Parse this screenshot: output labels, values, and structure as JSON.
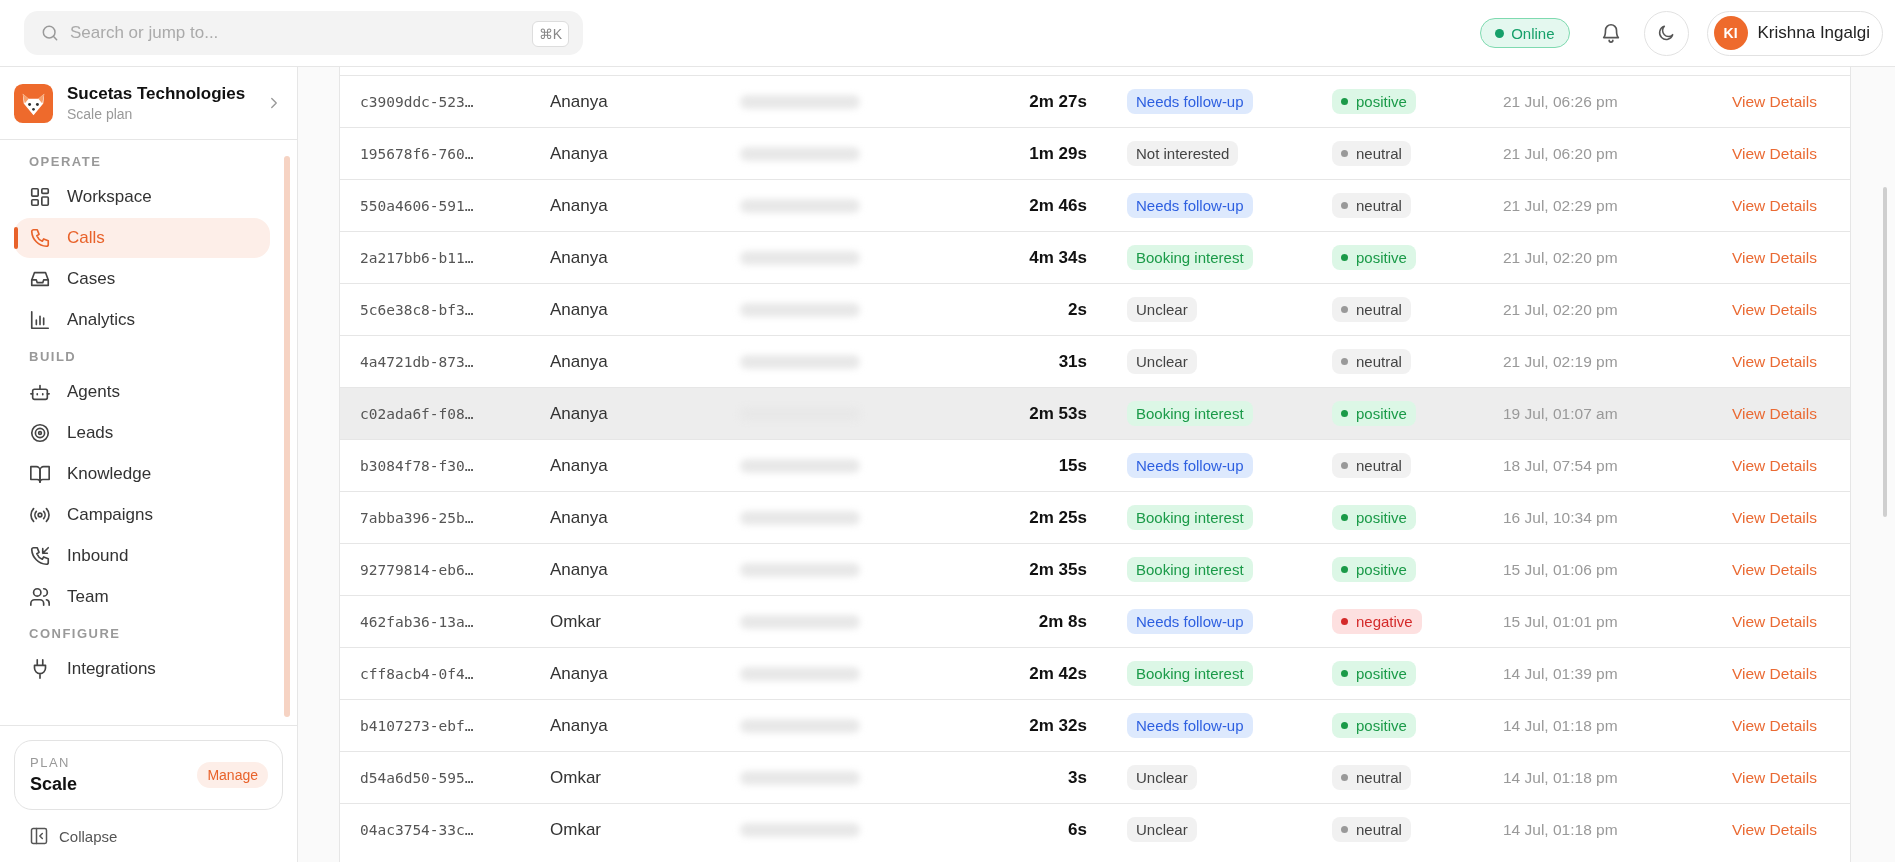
{
  "topbar": {
    "search": {
      "placeholder": "Search or jump to...",
      "shortcut": "⌘K"
    },
    "status": {
      "label": "Online",
      "online": true
    },
    "user": {
      "initials": "KI",
      "name": "Krishna Ingalgi"
    }
  },
  "sidebar": {
    "org": {
      "name": "Sucetas Technologies",
      "plan": "Scale plan"
    },
    "sections": [
      {
        "title": "OPERATE",
        "items": [
          {
            "label": "Workspace",
            "selected": false
          },
          {
            "label": "Calls",
            "selected": true
          },
          {
            "label": "Cases",
            "selected": false
          },
          {
            "label": "Analytics",
            "selected": false
          }
        ]
      },
      {
        "title": "BUILD",
        "items": [
          {
            "label": "Agents",
            "selected": false
          },
          {
            "label": "Leads",
            "selected": false
          },
          {
            "label": "Knowledge",
            "selected": false
          },
          {
            "label": "Campaigns",
            "selected": false
          },
          {
            "label": "Inbound",
            "selected": false
          },
          {
            "label": "Team",
            "selected": false
          }
        ]
      },
      {
        "title": "CONFIGURE",
        "items": [
          {
            "label": "Integrations",
            "selected": false
          }
        ]
      }
    ],
    "plan_card": {
      "label": "PLAN",
      "value": "Scale",
      "action": "Manage"
    },
    "collapse": "Collapse"
  },
  "table": {
    "rows": [
      {
        "id": "c3909ddc-523…",
        "agent": "Ananya",
        "duration": "2m 27s",
        "outcome": {
          "label": "Needs follow-up",
          "kind": "followup"
        },
        "sentiment": {
          "label": "positive",
          "kind": "positive"
        },
        "date": "21 Jul, 06:26 pm",
        "action": "View Details",
        "highlighted": false
      },
      {
        "id": "195678f6-760…",
        "agent": "Ananya",
        "duration": "1m 29s",
        "outcome": {
          "label": "Not interested",
          "kind": "neutral"
        },
        "sentiment": {
          "label": "neutral",
          "kind": "neutral"
        },
        "date": "21 Jul, 06:20 pm",
        "action": "View Details",
        "highlighted": false
      },
      {
        "id": "550a4606-591…",
        "agent": "Ananya",
        "duration": "2m 46s",
        "outcome": {
          "label": "Needs follow-up",
          "kind": "followup"
        },
        "sentiment": {
          "label": "neutral",
          "kind": "neutral"
        },
        "date": "21 Jul, 02:29 pm",
        "action": "View Details",
        "highlighted": false
      },
      {
        "id": "2a217bb6-b11…",
        "agent": "Ananya",
        "duration": "4m 34s",
        "outcome": {
          "label": "Booking interest",
          "kind": "booking"
        },
        "sentiment": {
          "label": "positive",
          "kind": "positive"
        },
        "date": "21 Jul, 02:20 pm",
        "action": "View Details",
        "highlighted": false
      },
      {
        "id": "5c6e38c8-bf3…",
        "agent": "Ananya",
        "duration": "2s",
        "outcome": {
          "label": "Unclear",
          "kind": "neutral"
        },
        "sentiment": {
          "label": "neutral",
          "kind": "neutral"
        },
        "date": "21 Jul, 02:20 pm",
        "action": "View Details",
        "highlighted": false
      },
      {
        "id": "4a4721db-873…",
        "agent": "Ananya",
        "duration": "31s",
        "outcome": {
          "label": "Unclear",
          "kind": "neutral"
        },
        "sentiment": {
          "label": "neutral",
          "kind": "neutral"
        },
        "date": "21 Jul, 02:19 pm",
        "action": "View Details",
        "highlighted": false
      },
      {
        "id": "c02ada6f-f08…",
        "agent": "Ananya",
        "duration": "2m 53s",
        "outcome": {
          "label": "Booking interest",
          "kind": "booking"
        },
        "sentiment": {
          "label": "positive",
          "kind": "positive"
        },
        "date": "19 Jul, 01:07 am",
        "action": "View Details",
        "highlighted": true
      },
      {
        "id": "b3084f78-f30…",
        "agent": "Ananya",
        "duration": "15s",
        "outcome": {
          "label": "Needs follow-up",
          "kind": "followup"
        },
        "sentiment": {
          "label": "neutral",
          "kind": "neutral"
        },
        "date": "18 Jul, 07:54 pm",
        "action": "View Details",
        "highlighted": false
      },
      {
        "id": "7abba396-25b…",
        "agent": "Ananya",
        "duration": "2m 25s",
        "outcome": {
          "label": "Booking interest",
          "kind": "booking"
        },
        "sentiment": {
          "label": "positive",
          "kind": "positive"
        },
        "date": "16 Jul, 10:34 pm",
        "action": "View Details",
        "highlighted": false
      },
      {
        "id": "92779814-eb6…",
        "agent": "Ananya",
        "duration": "2m 35s",
        "outcome": {
          "label": "Booking interest",
          "kind": "booking"
        },
        "sentiment": {
          "label": "positive",
          "kind": "positive"
        },
        "date": "15 Jul, 01:06 pm",
        "action": "View Details",
        "highlighted": false
      },
      {
        "id": "462fab36-13a…",
        "agent": "Omkar",
        "duration": "2m 8s",
        "outcome": {
          "label": "Needs follow-up",
          "kind": "followup"
        },
        "sentiment": {
          "label": "negative",
          "kind": "negative"
        },
        "date": "15 Jul, 01:01 pm",
        "action": "View Details",
        "highlighted": false
      },
      {
        "id": "cff8acb4-0f4…",
        "agent": "Ananya",
        "duration": "2m 42s",
        "outcome": {
          "label": "Booking interest",
          "kind": "booking"
        },
        "sentiment": {
          "label": "positive",
          "kind": "positive"
        },
        "date": "14 Jul, 01:39 pm",
        "action": "View Details",
        "highlighted": false
      },
      {
        "id": "b4107273-ebf…",
        "agent": "Ananya",
        "duration": "2m 32s",
        "outcome": {
          "label": "Needs follow-up",
          "kind": "followup"
        },
        "sentiment": {
          "label": "positive",
          "kind": "positive"
        },
        "date": "14 Jul, 01:18 pm",
        "action": "View Details",
        "highlighted": false
      },
      {
        "id": "d54a6d50-595…",
        "agent": "Omkar",
        "duration": "3s",
        "outcome": {
          "label": "Unclear",
          "kind": "neutral"
        },
        "sentiment": {
          "label": "neutral",
          "kind": "neutral"
        },
        "date": "14 Jul, 01:18 pm",
        "action": "View Details",
        "highlighted": false
      },
      {
        "id": "04ac3754-33c…",
        "agent": "Omkar",
        "duration": "6s",
        "outcome": {
          "label": "Unclear",
          "kind": "neutral"
        },
        "sentiment": {
          "label": "neutral",
          "kind": "neutral"
        },
        "date": "14 Jul, 01:18 pm",
        "action": "View Details",
        "highlighted": false
      }
    ]
  }
}
